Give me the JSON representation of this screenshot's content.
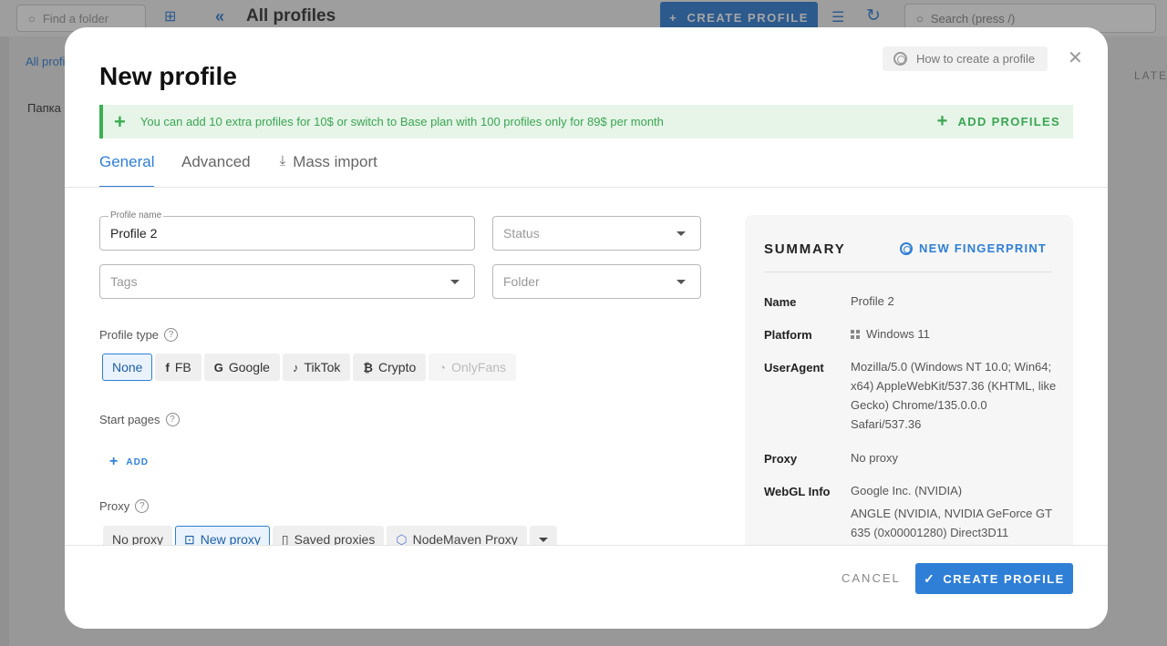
{
  "background": {
    "folder_search_placeholder": "Find a folder",
    "page_title": "All profiles",
    "create_button": "CREATE PROFILE",
    "search_placeholder": "Search (press /)",
    "sidebar_all": "All profi",
    "sidebar_folder": "Папка",
    "column_header": "LATE"
  },
  "modal": {
    "title": "New profile",
    "help_button": "How to create a profile",
    "banner": {
      "text": "You can add 10 extra profiles for 10$ or switch to Base plan with 100 profiles only for 89$ per month",
      "action": "ADD PROFILES"
    },
    "tabs": [
      {
        "label": "General",
        "active": true
      },
      {
        "label": "Advanced",
        "active": false
      },
      {
        "label": "Mass import",
        "active": false
      }
    ],
    "form": {
      "profile_name_label": "Profile name",
      "profile_name_value": "Profile 2",
      "status_placeholder": "Status",
      "tags_placeholder": "Tags",
      "folder_placeholder": "Folder",
      "profile_type_label": "Profile type",
      "profile_types": [
        {
          "label": "None",
          "icon": "",
          "state": "selected"
        },
        {
          "label": "FB",
          "icon": "facebook-icon",
          "state": "normal"
        },
        {
          "label": "Google",
          "icon": "google-icon",
          "state": "normal"
        },
        {
          "label": "TikTok",
          "icon": "tiktok-icon",
          "state": "normal"
        },
        {
          "label": "Crypto",
          "icon": "bitcoin-icon",
          "state": "normal"
        },
        {
          "label": "OnlyFans",
          "icon": "onlyfans-icon",
          "state": "disabled"
        }
      ],
      "start_pages_label": "Start pages",
      "add_label": "ADD",
      "proxy_label": "Proxy",
      "proxy_options": [
        {
          "label": "No proxy",
          "state": "normal"
        },
        {
          "label": "New proxy",
          "state": "selected"
        },
        {
          "label": "Saved proxies",
          "state": "normal"
        },
        {
          "label": "NodeMaven Proxy",
          "state": "normal"
        }
      ]
    },
    "summary": {
      "title": "SUMMARY",
      "new_fingerprint": "NEW FINGERPRINT",
      "rows": {
        "name_key": "Name",
        "name_val": "Profile 2",
        "platform_key": "Platform",
        "platform_val": "Windows 11",
        "ua_key": "UserAgent",
        "ua_val": "Mozilla/5.0 (Windows NT 10.0; Win64; x64) AppleWebKit/537.36 (KHTML, like Gecko) Chrome/135.0.0.0 Safari/537.36",
        "proxy_key": "Proxy",
        "proxy_val": "No proxy",
        "webgl_key": "WebGL Info",
        "webgl_vendor": "Google Inc. (NVIDIA)",
        "webgl_renderer": "ANGLE (NVIDIA, NVIDIA GeForce GT 635 (0x00001280) Direct3D11"
      }
    },
    "footer": {
      "cancel": "CANCEL",
      "create": "CREATE PROFILE"
    }
  },
  "colors": {
    "accent": "#2f7fd6",
    "success": "#3daf52"
  }
}
